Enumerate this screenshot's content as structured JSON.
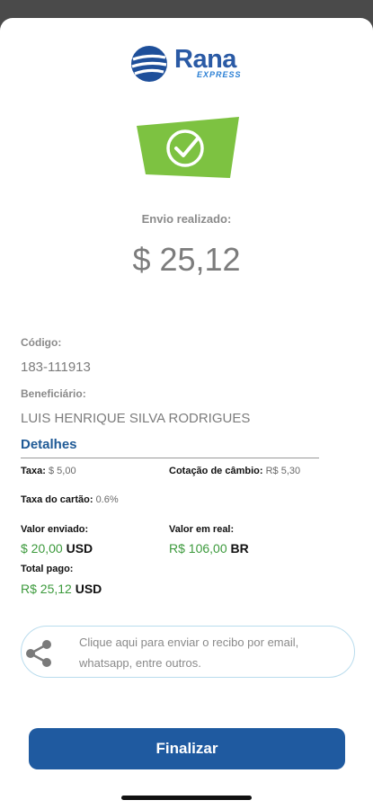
{
  "brand": {
    "name": "Rana",
    "tagline": "EXPRESS",
    "primary_color": "#1f5aa0",
    "accent_green": "#7dc241"
  },
  "icons": {
    "logo": "globe-icon",
    "status": "check-circle-icon",
    "share": "share-icon"
  },
  "status": {
    "label": "Envio realizado:",
    "amount": "$ 25,12"
  },
  "codigo": {
    "label": "Código:",
    "value": "183-111913"
  },
  "beneficiario": {
    "label": "Beneficiário:",
    "value": "LUIS HENRIQUE SILVA RODRIGUES"
  },
  "details": {
    "title": "Detalhes",
    "taxa": {
      "label": "Taxa:",
      "value": "$ 5,00"
    },
    "cotacao": {
      "label": "Cotação de câmbio:",
      "value": "R$ 5,30"
    },
    "taxa_cartao": {
      "label": "Taxa do cartão:",
      "value": "0.6%"
    },
    "valor_enviado": {
      "label": "Valor enviado:",
      "amount": "$ 20,00",
      "currency": "USD"
    },
    "valor_real": {
      "label": "Valor em real:",
      "amount": "R$ 106,00",
      "currency": "BR"
    },
    "total_pago": {
      "label": "Total pago:",
      "amount": "R$ 25,12",
      "currency": "USD"
    }
  },
  "share": {
    "text": "Clique aqui para enviar o recibo por email, whatsapp, entre outros."
  },
  "actions": {
    "finalizar_label": "Finalizar"
  }
}
